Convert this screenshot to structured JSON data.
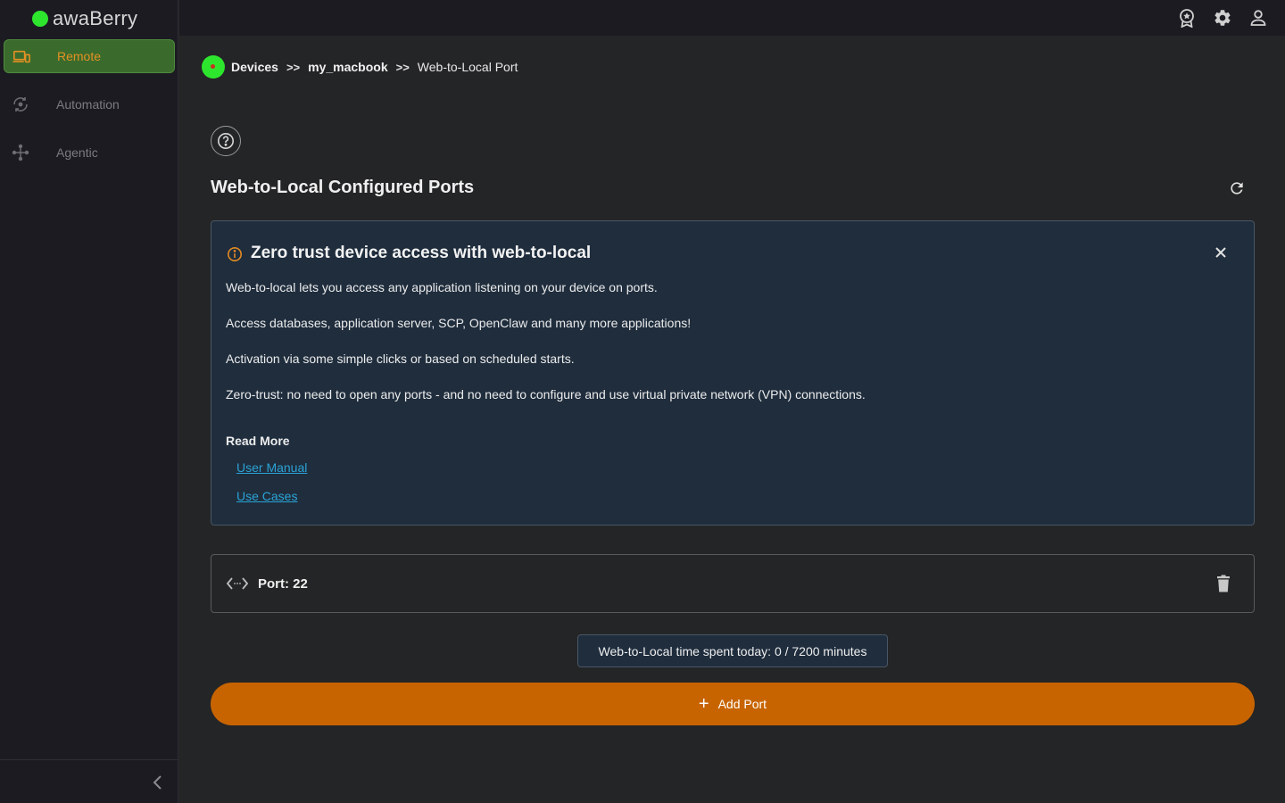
{
  "brand": {
    "name": "awaBerry"
  },
  "sidebar": {
    "items": [
      {
        "label": "Remote",
        "icon": "devices-icon",
        "active": true
      },
      {
        "label": "Automation",
        "icon": "automation-icon",
        "active": false
      },
      {
        "label": "Agentic",
        "icon": "agentic-icon",
        "active": false
      }
    ]
  },
  "topbar": {
    "icons": [
      "award-icon",
      "gear-icon",
      "account-icon"
    ]
  },
  "breadcrumb": {
    "items": [
      "Devices",
      "my_macbook",
      "Web-to-Local Port"
    ],
    "separator": ">>"
  },
  "page": {
    "title": "Web-to-Local Configured Ports"
  },
  "info": {
    "title": "Zero trust device access with web-to-local",
    "paragraphs": [
      "Web-to-local lets you access any application listening on your device on ports.",
      "Access databases, application server, SCP, OpenClaw and many more applications!",
      "Activation via some simple clicks or based on scheduled starts.",
      "Zero-trust: no need to open any ports - and no need to configure and use virtual private network (VPN) connections."
    ],
    "read_more_label": "Read More",
    "links": [
      "User Manual",
      "Use Cases"
    ]
  },
  "ports": [
    {
      "label": "Port: 22"
    }
  ],
  "usage": {
    "text": "Web-to-Local time spent today: 0 / 7200 minutes"
  },
  "actions": {
    "add_port_label": "Add Port"
  },
  "colors": {
    "accent": "#c86400",
    "active_nav_bg": "#3a6b2c",
    "active_nav_text": "#e49023",
    "online_dot": "#2ee52e",
    "link": "#2ba3d6",
    "info_bg": "#1f2d3d"
  }
}
